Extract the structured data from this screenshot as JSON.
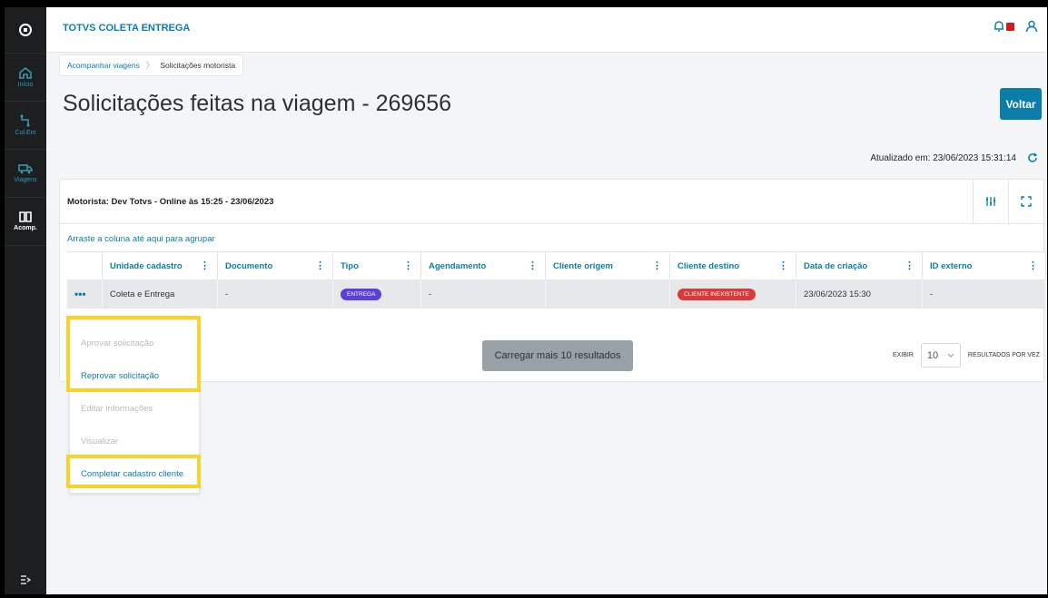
{
  "app": {
    "title": "TOTVS COLETA ENTREGA"
  },
  "sidebar": {
    "items": [
      {
        "label": "Início",
        "icon": "home-icon"
      },
      {
        "label": "Col.Ent",
        "icon": "route-icon"
      },
      {
        "label": "Viagens",
        "icon": "truck-icon"
      },
      {
        "label": "Acomp.",
        "icon": "book-icon"
      }
    ]
  },
  "header": {
    "notifications_icon": "bell-icon",
    "user_icon": "user-icon"
  },
  "breadcrumb": {
    "item1": "Acompanhar viagens",
    "item2": "Solicitações motorista"
  },
  "page": {
    "title": "Solicitações feitas na viagem - 269656",
    "back_label": "Voltar",
    "updated_text": "Atualizado em: 23/06/2023 15:31:14"
  },
  "card": {
    "driver": "Motorista: Dev Totvs - Online às 15:25 - 23/06/2023",
    "group_hint": "Arraste a coluna até aqui para agrupar"
  },
  "table": {
    "columns": [
      "Unidade cadastro",
      "Documento",
      "Tipo",
      "Agendamento",
      "Cliente origem",
      "Cliente destino",
      "Data de criação",
      "ID externo"
    ],
    "row": {
      "unidade": "Coleta e Entrega",
      "documento": "-",
      "tipo": "ENTREGA",
      "agendamento": "-",
      "cliente_origem": "",
      "cliente_destino": "CLIENTE INEXISTENTE",
      "data_criacao": "23/06/2023 15:30",
      "id_externo": "-"
    }
  },
  "load_more": "Carregar mais 10 resultados",
  "pager": {
    "show_label": "EXIBIR",
    "value": "10",
    "suffix": "RESULTADOS POR VEZ"
  },
  "menu": {
    "items": [
      "Aprovar solicitação",
      "Reprovar solicitação",
      "Editar informações",
      "Visualizar",
      "Completar cadastro cliente"
    ]
  },
  "colors": {
    "accent": "#0c7da8",
    "badge_tipo": "#5b3fd6",
    "badge_cliente": "#d63a3a",
    "highlight": "#f6d32d"
  }
}
